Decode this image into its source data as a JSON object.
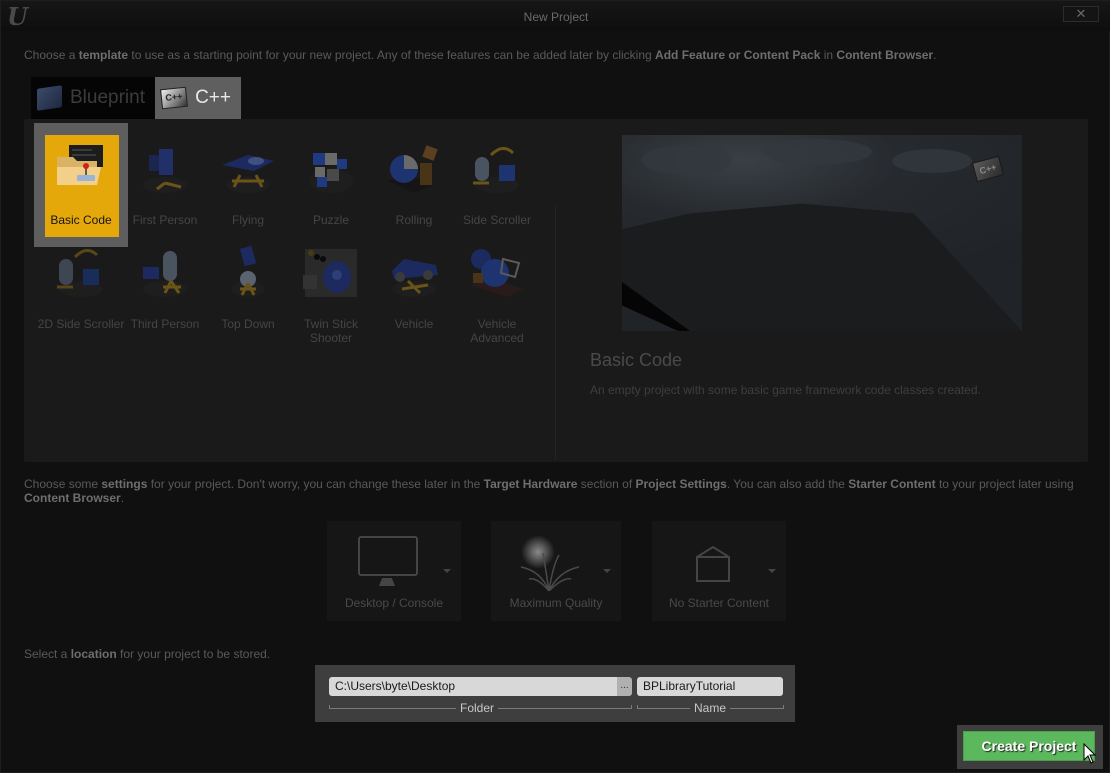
{
  "window": {
    "title": "New Project",
    "logo": "U",
    "close_label": "✕"
  },
  "intro": {
    "parts": [
      {
        "text": "Choose a ",
        "bold": false
      },
      {
        "text": "template",
        "bold": true
      },
      {
        "text": " to use as a starting point for your new project.  Any of these features can be added later by clicking ",
        "bold": false
      },
      {
        "text": "Add Feature or Content Pack",
        "bold": true
      },
      {
        "text": " in ",
        "bold": false
      },
      {
        "text": "Content Browser",
        "bold": true
      },
      {
        "text": ".",
        "bold": false
      }
    ]
  },
  "tabs": [
    {
      "label": "Blueprint",
      "icon": "blueprint-icon",
      "active": false
    },
    {
      "label": "C++",
      "icon": "cpp-icon",
      "icon_text": "C++",
      "active": true
    }
  ],
  "templates": [
    {
      "label": "Basic Code",
      "selected": true
    },
    {
      "label": "First Person"
    },
    {
      "label": "Flying"
    },
    {
      "label": "Puzzle"
    },
    {
      "label": "Rolling"
    },
    {
      "label": "Side Scroller"
    },
    {
      "label": "2D Side Scroller"
    },
    {
      "label": "Third Person"
    },
    {
      "label": "Top Down"
    },
    {
      "label": "Twin Stick Shooter"
    },
    {
      "label": "Vehicle"
    },
    {
      "label": "Vehicle Advanced"
    }
  ],
  "details": {
    "title": "Basic Code",
    "description": "An empty project with some basic game framework code classes created.",
    "preview_badge": "C++"
  },
  "settings_intro": {
    "parts": [
      {
        "text": "Choose some ",
        "bold": false
      },
      {
        "text": "settings",
        "bold": true
      },
      {
        "text": " for your project.  Don't worry, you can change these later in the ",
        "bold": false
      },
      {
        "text": "Target Hardware",
        "bold": true
      },
      {
        "text": " section of ",
        "bold": false
      },
      {
        "text": "Project Settings",
        "bold": true
      },
      {
        "text": ".  You can also add the ",
        "bold": false
      },
      {
        "text": "Starter Content",
        "bold": true
      },
      {
        "text": " to your project later using ",
        "bold": false
      },
      {
        "text": "Content Browser",
        "bold": true
      },
      {
        "text": ".",
        "bold": false
      }
    ]
  },
  "settings": [
    {
      "label": "Desktop / Console",
      "icon": "monitor-icon"
    },
    {
      "label": "Maximum Quality",
      "icon": "quality-icon"
    },
    {
      "label": "No Starter Content",
      "icon": "starter-content-icon"
    }
  ],
  "location_intro": {
    "parts": [
      {
        "text": "Select a ",
        "bold": false
      },
      {
        "text": "location",
        "bold": true
      },
      {
        "text": " for your project to be stored.",
        "bold": false
      }
    ]
  },
  "location": {
    "folder_value": "C:\\Users\\byte\\Desktop",
    "browse_label": "...",
    "name_value": "BPLibraryTutorial",
    "folder_caption": "Folder",
    "name_caption": "Name"
  },
  "create_button": "Create Project",
  "colors": {
    "selected_tile": "#e4a80a",
    "create_button": "#5cb85c"
  }
}
